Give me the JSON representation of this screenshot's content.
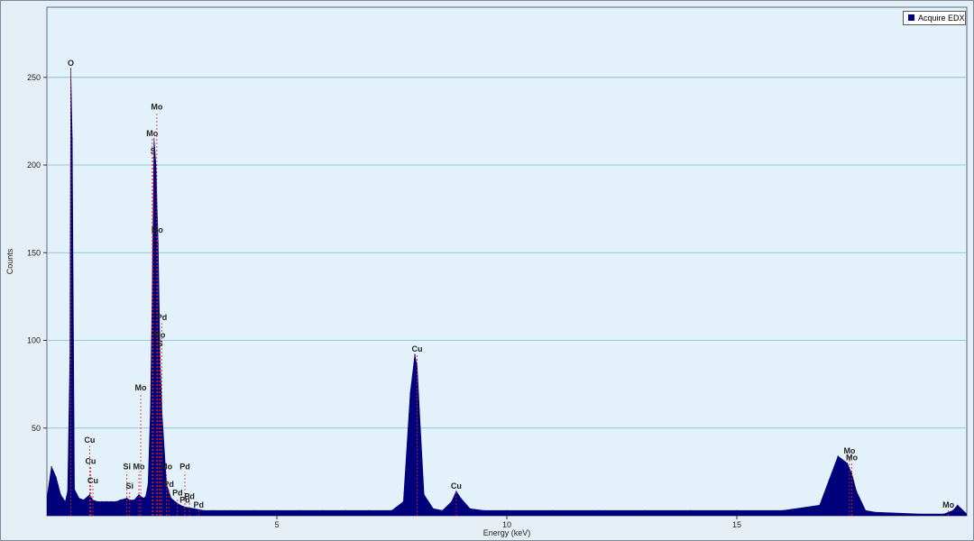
{
  "chart_data": {
    "type": "area",
    "title": "",
    "xlabel": "Energy (keV)",
    "ylabel": "Counts",
    "xlim": [
      0,
      20
    ],
    "ylim": [
      0,
      290
    ],
    "x_ticks": [
      5,
      10,
      15
    ],
    "y_ticks": [
      50,
      100,
      150,
      200,
      250
    ],
    "grid": "horizontal",
    "legend_position": "top-right",
    "series": [
      {
        "name": "Acquire EDX",
        "color": "#00007a",
        "x": [
          0.0,
          0.1,
          0.2,
          0.3,
          0.4,
          0.45,
          0.5,
          0.52,
          0.55,
          0.6,
          0.7,
          0.8,
          0.93,
          1.0,
          1.1,
          1.2,
          1.3,
          1.4,
          1.5,
          1.6,
          1.74,
          1.8,
          1.9,
          2.0,
          2.1,
          2.15,
          2.2,
          2.25,
          2.29,
          2.33,
          2.37,
          2.42,
          2.46,
          2.5,
          2.6,
          2.7,
          2.84,
          2.9,
          3.0,
          3.2,
          3.4,
          3.6,
          4.0,
          4.5,
          5.0,
          5.5,
          6.0,
          6.5,
          7.0,
          7.5,
          7.75,
          7.9,
          8.0,
          8.05,
          8.1,
          8.2,
          8.4,
          8.6,
          8.8,
          8.9,
          9.0,
          9.2,
          9.5,
          10.0,
          11.0,
          12.0,
          13.0,
          14.0,
          15.0,
          16.0,
          16.8,
          17.0,
          17.2,
          17.4,
          17.5,
          17.6,
          17.8,
          18.0,
          19.0,
          19.5,
          19.7,
          19.8,
          20.0
        ],
        "y": [
          10,
          28,
          22,
          12,
          8,
          14,
          90,
          255,
          215,
          15,
          10,
          9,
          12,
          9,
          8,
          8,
          8,
          8,
          8,
          9,
          10,
          9,
          9,
          12,
          10,
          11,
          18,
          60,
          130,
          215,
          200,
          155,
          90,
          60,
          18,
          10,
          7,
          6,
          5,
          4,
          3,
          3,
          3,
          3,
          3,
          3,
          3,
          3,
          3,
          3,
          8,
          70,
          92,
          85,
          60,
          12,
          4,
          3,
          8,
          14,
          10,
          4,
          3,
          3,
          3,
          3,
          3,
          3,
          3,
          3,
          6,
          20,
          34,
          30,
          24,
          14,
          3,
          2,
          1,
          1,
          3,
          6,
          1
        ],
        "peaks": [
          {
            "element": "O",
            "energy": 0.52,
            "counts": 255
          },
          {
            "element": "Cu",
            "energy": 0.93,
            "counts": 40
          },
          {
            "element": "Cu",
            "energy": 0.95,
            "counts": 28
          },
          {
            "element": "Cu",
            "energy": 1.0,
            "counts": 17
          },
          {
            "element": "Si",
            "energy": 1.74,
            "counts": 25
          },
          {
            "element": "Si",
            "energy": 1.8,
            "counts": 14
          },
          {
            "element": "Mo",
            "energy": 2.04,
            "counts": 70
          },
          {
            "element": "Mo",
            "energy": 2.0,
            "counts": 25
          },
          {
            "element": "Mo",
            "energy": 2.29,
            "counts": 215
          },
          {
            "element": "S",
            "energy": 2.31,
            "counts": 205
          },
          {
            "element": "Mo",
            "energy": 2.39,
            "counts": 230
          },
          {
            "element": "Mo",
            "energy": 2.4,
            "counts": 160
          },
          {
            "element": "Pd",
            "energy": 2.5,
            "counts": 110
          },
          {
            "element": "Mo",
            "energy": 2.45,
            "counts": 100
          },
          {
            "element": "S",
            "energy": 2.46,
            "counts": 95
          },
          {
            "element": "Mo",
            "energy": 2.6,
            "counts": 25
          },
          {
            "element": "Pd",
            "energy": 2.65,
            "counts": 15
          },
          {
            "element": "Pd",
            "energy": 2.84,
            "counts": 10
          },
          {
            "element": "Pd",
            "energy": 3.0,
            "counts": 25
          },
          {
            "element": "Pd",
            "energy": 3.0,
            "counts": 6
          },
          {
            "element": "Pd",
            "energy": 3.1,
            "counts": 8
          },
          {
            "element": "Pd",
            "energy": 3.3,
            "counts": 3
          },
          {
            "element": "Cu",
            "energy": 8.05,
            "counts": 92
          },
          {
            "element": "Cu",
            "energy": 8.9,
            "counts": 14
          },
          {
            "element": "Mo",
            "energy": 17.45,
            "counts": 34
          },
          {
            "element": "Mo",
            "energy": 17.5,
            "counts": 30
          },
          {
            "element": "Mo",
            "energy": 19.6,
            "counts": 3
          }
        ]
      }
    ]
  }
}
